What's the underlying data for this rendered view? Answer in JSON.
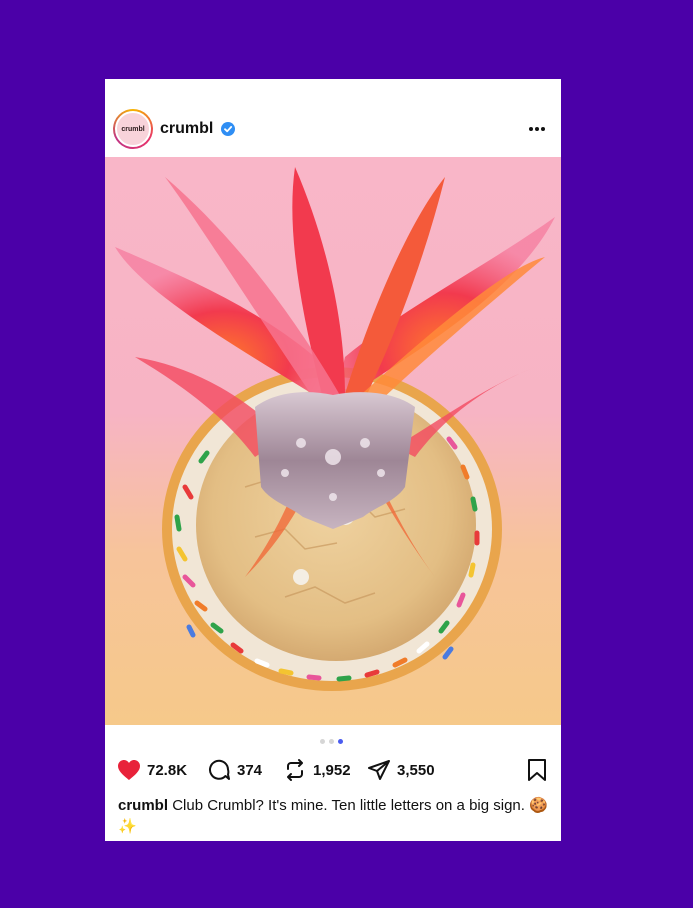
{
  "post": {
    "avatar_text": "crumbl",
    "username": "crumbl",
    "verified": true,
    "more_icon": "more-horizontal-icon",
    "carousel": {
      "total": 3,
      "active_index": 2
    },
    "actions": {
      "likes": "72.8K",
      "comments": "374",
      "reposts": "1,952",
      "shares": "3,550"
    },
    "caption": {
      "username": "crumbl",
      "text": "Club Crumbl? It's mine. Ten little letters on a big sign. 🍪✨"
    }
  },
  "colors": {
    "page_background": "#4B00A8",
    "like_red": "#E8223A",
    "verified_blue": "#2F8EF4",
    "carousel_active": "#4A5CF0"
  }
}
